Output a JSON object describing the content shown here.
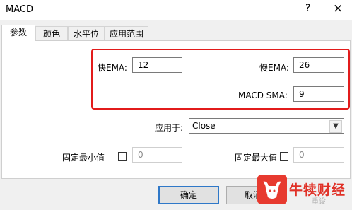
{
  "window": {
    "title": "MACD",
    "help_label": "?",
    "close_label": "×"
  },
  "tabs": [
    {
      "label": "参数",
      "active": true
    },
    {
      "label": "颜色",
      "active": false
    },
    {
      "label": "水平位",
      "active": false
    },
    {
      "label": "应用范围",
      "active": false
    }
  ],
  "params": {
    "fast_ema_label": "快EMA:",
    "fast_ema_value": "12",
    "slow_ema_label": "慢EMA:",
    "slow_ema_value": "26",
    "macd_sma_label": "MACD SMA:",
    "macd_sma_value": "9",
    "apply_to_label": "应用于:",
    "apply_to_value": "Close",
    "fixed_min_label": "固定最小值",
    "fixed_min_value": "0",
    "fixed_max_label": "固定最大值",
    "fixed_max_value": "0"
  },
  "buttons": {
    "ok": "确定",
    "cancel": "取消"
  },
  "watermark": {
    "brand": "牛犊财经",
    "sub": "重设"
  },
  "colors": {
    "highlight": "#e21b1b",
    "primary_border": "#2f78c8",
    "brand": "#e03127"
  }
}
